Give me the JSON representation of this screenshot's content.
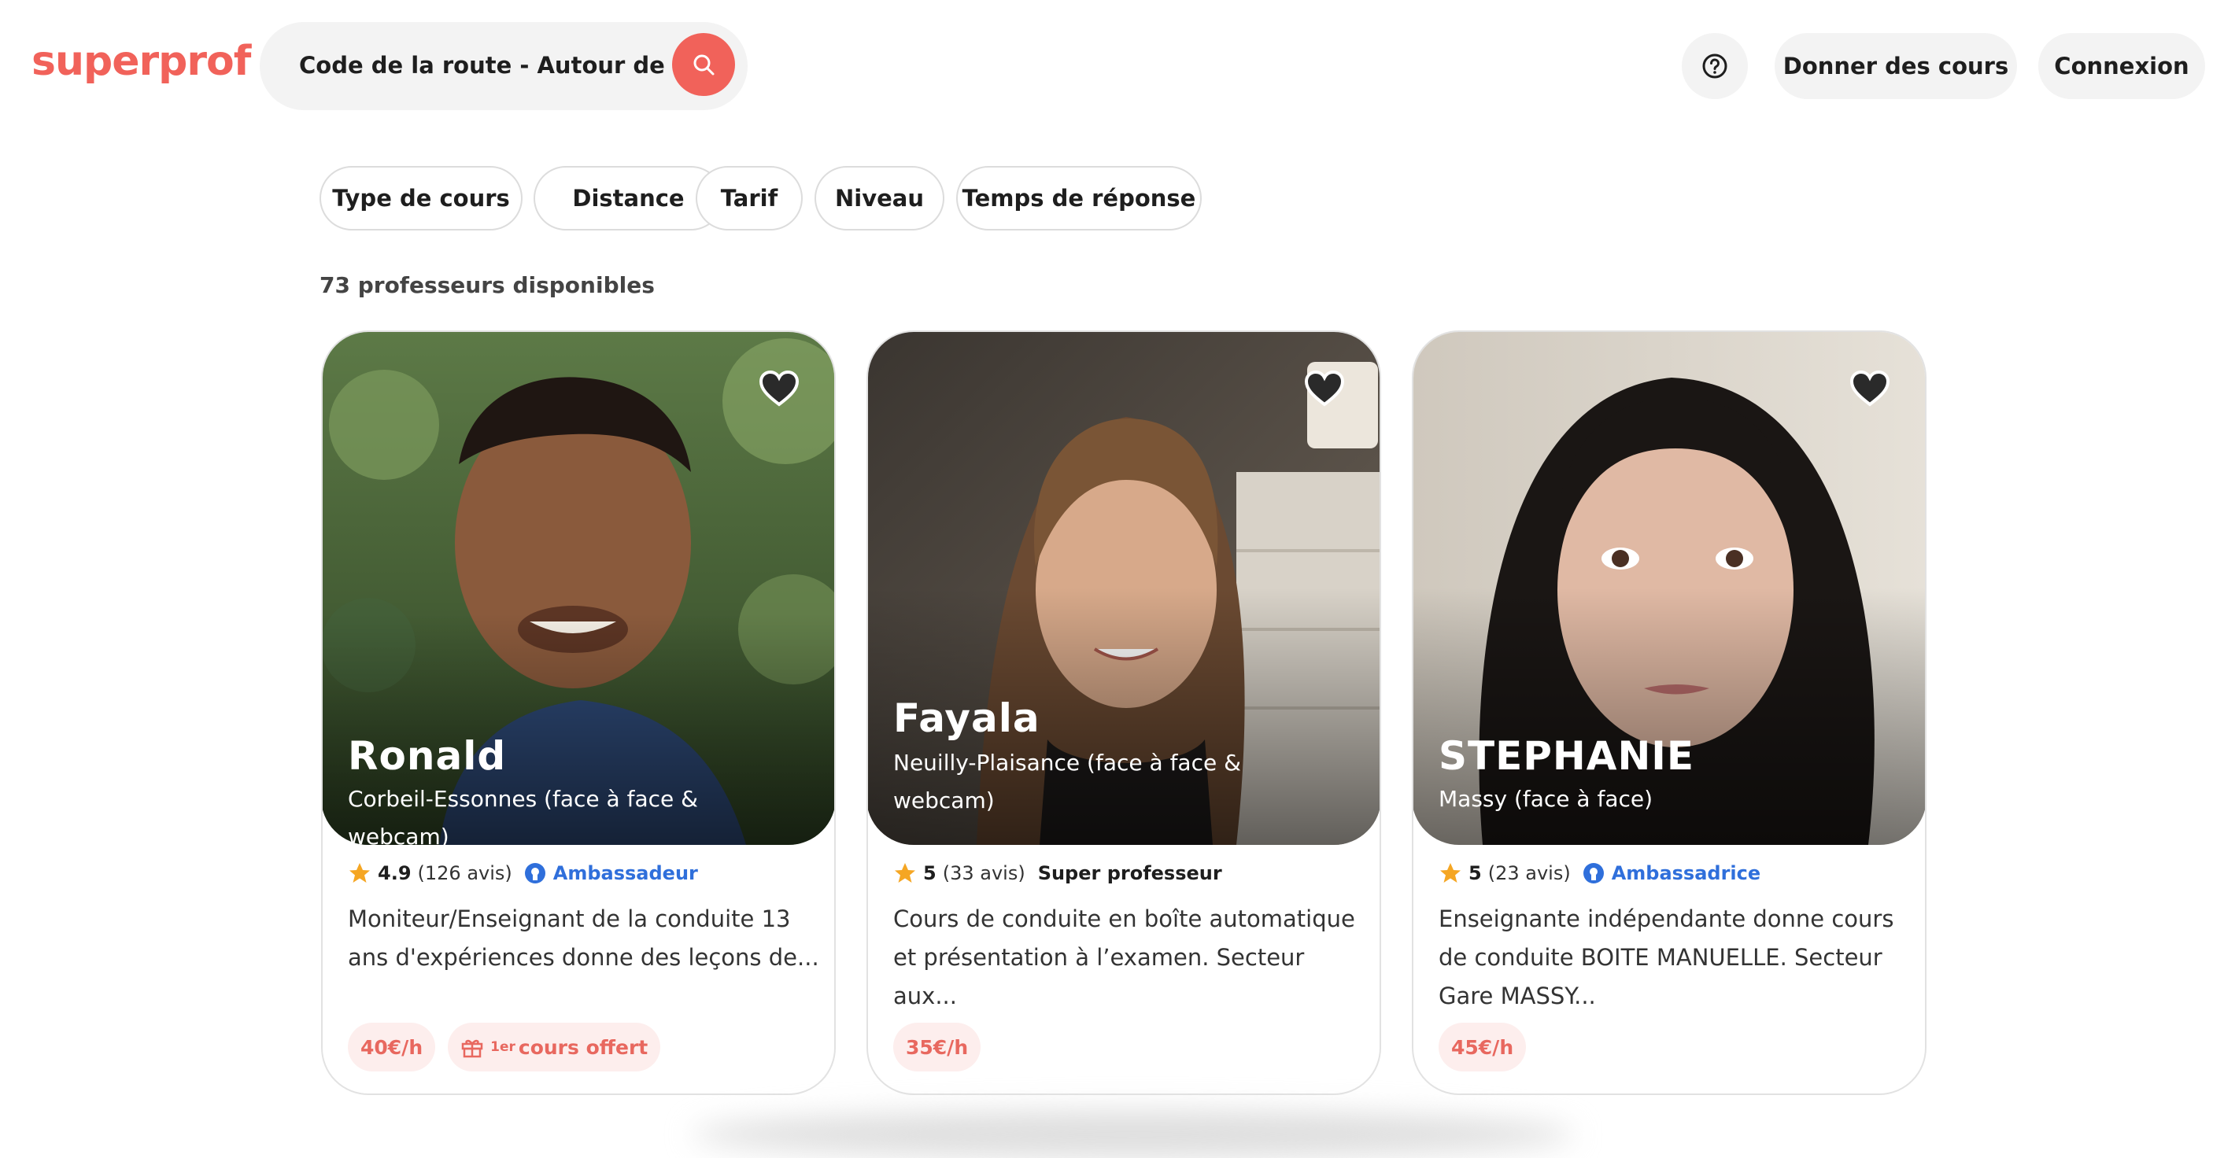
{
  "colors": {
    "brand": "#f1625a",
    "accent_blue": "#2f6fdb",
    "star": "#f5a623",
    "tag_bg": "#fdeeed"
  },
  "header": {
    "logo": "superprof",
    "search_text": "Code de la route - Autour de moi",
    "give_courses": "Donner des cours",
    "login": "Connexion"
  },
  "filters": [
    "Type de cours",
    "Distance",
    "Tarif",
    "Niveau",
    "Temps de réponse"
  ],
  "results_count": "73 professeurs disponibles",
  "teachers": [
    {
      "name": "Ronald",
      "location": "Corbeil-Essonnes (face à face & webcam)",
      "rating": "4.9",
      "reviews": "(126 avis)",
      "badge": "Ambassadeur",
      "description": "Moniteur/Enseignant de la conduite 13 ans d'expériences donne des leçons de...",
      "price": "40€/h",
      "offer_sup": "1er",
      "offer_text": "cours offert"
    },
    {
      "name": "Fayala",
      "location": "Neuilly-Plaisance (face à face & webcam)",
      "rating": "5",
      "reviews": "(33 avis)",
      "badge": "Super professeur",
      "description": "Cours de conduite en boîte automatique et présentation à l’examen. Secteur aux...",
      "price": "35€/h"
    },
    {
      "name": "STEPHANIE",
      "location": "Massy (face à face)",
      "rating": "5",
      "reviews": "(23 avis)",
      "badge": "Ambassadrice",
      "description": "Enseignante indépendante donne cours de conduite BOITE MANUELLE. Secteur Gare MASSY...",
      "price": "45€/h"
    }
  ],
  "icons": {
    "search": "search-icon",
    "help": "question-circle-icon",
    "favorite": "heart-icon",
    "rating": "star-icon",
    "badge": "ambassador-badge-icon",
    "gift": "gift-icon"
  }
}
